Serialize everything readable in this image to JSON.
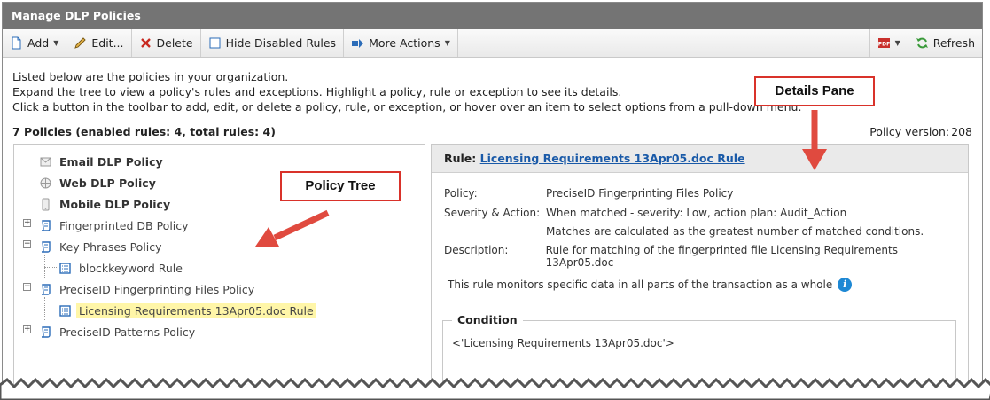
{
  "window": {
    "title": "Manage DLP Policies"
  },
  "toolbar": {
    "add": "Add",
    "edit": "Edit...",
    "delete": "Delete",
    "hide_disabled": "Hide Disabled Rules",
    "more_actions": "More Actions",
    "pdf_icon_text": "PDF",
    "refresh": "Refresh"
  },
  "intro": {
    "line1": "Listed below are the policies in your organization.",
    "line2": "Expand the tree to view a policy's rules and exceptions. Highlight a policy, rule or exception to see its details.",
    "line3": "Click a button in the toolbar to add, edit, or delete a policy, rule, or exception, or hover over an item to select options from a pull-down menu."
  },
  "summary": "7 Policies (enabled rules: 4, total rules: 4)",
  "policy_version": {
    "label": "Policy version:",
    "value": "208"
  },
  "tree": {
    "items": [
      {
        "label": "Email DLP Policy"
      },
      {
        "label": "Web DLP Policy"
      },
      {
        "label": "Mobile DLP Policy"
      },
      {
        "label": "Fingerprinted DB Policy"
      },
      {
        "label": "Key Phrases Policy"
      },
      {
        "label": "blockkeyword Rule"
      },
      {
        "label": "PreciseID Fingerprinting Files Policy"
      },
      {
        "label": "Licensing Requirements 13Apr05.doc Rule"
      },
      {
        "label": "PreciseID Patterns Policy"
      }
    ]
  },
  "details": {
    "header_prefix": "Rule:",
    "header_link": "Licensing Requirements 13Apr05.doc Rule",
    "policy_label": "Policy:",
    "policy_value": "PreciseID Fingerprinting Files Policy",
    "severity_label": "Severity & Action:",
    "severity_value": "When matched - severity: Low, action plan: Audit_Action",
    "severity_value2": "Matches are calculated as the greatest number of matched conditions.",
    "description_label": "Description:",
    "description_value": "Rule for matching of the fingerprinted file Licensing Requirements 13Apr05.doc",
    "monitor_text": "This rule monitors specific data in all parts of the transaction as a whole",
    "info_icon_text": "i",
    "condition_title": "Condition",
    "condition_value": "<'Licensing Requirements 13Apr05.doc'>"
  },
  "callouts": {
    "details_pane": "Details Pane",
    "policy_tree": "Policy Tree"
  },
  "colors": {
    "callout_border": "#d9322a",
    "arrow": "#e04a3f",
    "link": "#1a5aa8",
    "selection": "#fff6a8",
    "titlebar": "#747474"
  }
}
